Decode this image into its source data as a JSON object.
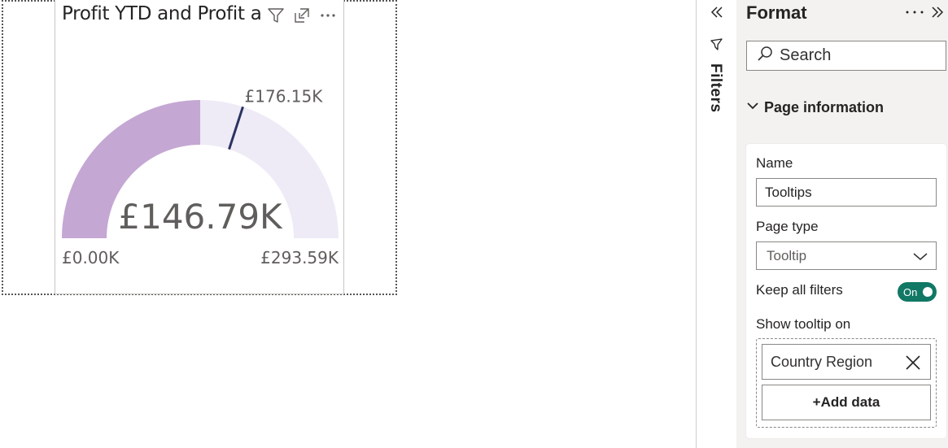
{
  "visual": {
    "title": "Profit YTD and Profit a",
    "header_icons": [
      "filter-icon",
      "focus-mode-icon",
      "more-options-icon"
    ]
  },
  "chart_data": {
    "type": "gauge",
    "title": "Profit YTD and Profit a",
    "value": 146.79,
    "value_label": "£146.79K",
    "min": 0,
    "min_label": "£0.00K",
    "max": 293.59,
    "max_label": "£293.59K",
    "target": 176.15,
    "target_label": "£176.15K",
    "colors": {
      "fill": "#c4a7d3",
      "track": "#eeebf7",
      "target": "#2b3360"
    }
  },
  "filters_pane": {
    "label": "Filters",
    "icons": [
      "collapse-left-icon",
      "filter-funnel-icon"
    ]
  },
  "format_pane": {
    "title": "Format",
    "search_placeholder": "Search",
    "section_title": "Page information",
    "name_label": "Name",
    "name_value": "Tooltips",
    "page_type_label": "Page type",
    "page_type_value": "Tooltip",
    "keep_filters_label": "Keep all filters",
    "keep_filters_toggle": "On",
    "show_tooltip_label": "Show tooltip on",
    "field_chip": "Country Region",
    "add_data_label": "+Add data",
    "accent_color": "#117865"
  }
}
